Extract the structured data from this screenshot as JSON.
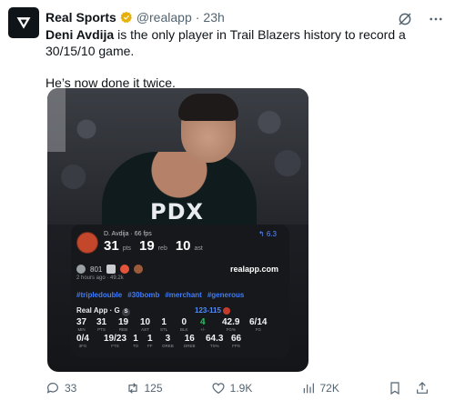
{
  "account": {
    "name": "Real Sports",
    "handle": "@realapp",
    "separator": "·",
    "time": "23h"
  },
  "tweet": {
    "player_name": "Deni Avdija",
    "line1_rest": " is the only player in Trail Blazers history to record a 30/15/10 game.",
    "line2": "He’s now done it twice."
  },
  "media": {
    "jersey": "PDX",
    "card": {
      "player": "D. Avdija · 66 fps",
      "pts": "31",
      "pts_label": "pts",
      "reb": "19",
      "reb_label": "reb",
      "ast": "10",
      "ast_label": "ast",
      "score": "↰ 6.3",
      "reaction_count": "801",
      "site": "realapp.com",
      "meta": "2 hours ago · 49.2k",
      "tags": [
        "#tripledouble",
        "#30bomb",
        "#merchant",
        "#generous"
      ],
      "app_line": "Real App · G",
      "badge": "S",
      "game_score": "123-115",
      "row1": [
        {
          "v": "37",
          "k": "MIN"
        },
        {
          "v": "31",
          "k": "PTS"
        },
        {
          "v": "19",
          "k": "REB"
        },
        {
          "v": "10",
          "k": "AST"
        },
        {
          "v": "1",
          "k": "STL"
        },
        {
          "v": "0",
          "k": "BLK"
        },
        {
          "v": "4",
          "k": "+/-"
        },
        {
          "v": "42.9",
          "k": "FG%"
        },
        {
          "v": "6/14",
          "k": "FG"
        }
      ],
      "row2": [
        {
          "v": "0/4",
          "k": "3FG"
        },
        {
          "v": "19/23",
          "k": "FTS"
        },
        {
          "v": "1",
          "k": "TO"
        },
        {
          "v": "1",
          "k": "FF"
        },
        {
          "v": "3",
          "k": "OREB"
        },
        {
          "v": "16",
          "k": "DREB"
        },
        {
          "v": "64.3",
          "k": "TS%"
        },
        {
          "v": "66",
          "k": "FPS"
        }
      ]
    }
  },
  "actions": {
    "replies": "33",
    "reposts": "125",
    "likes": "1.9K",
    "views": "72K"
  },
  "colors": {
    "accent": "#1d9bf0",
    "link": "#3f7cf6",
    "plus_minus": "#22c55e"
  }
}
